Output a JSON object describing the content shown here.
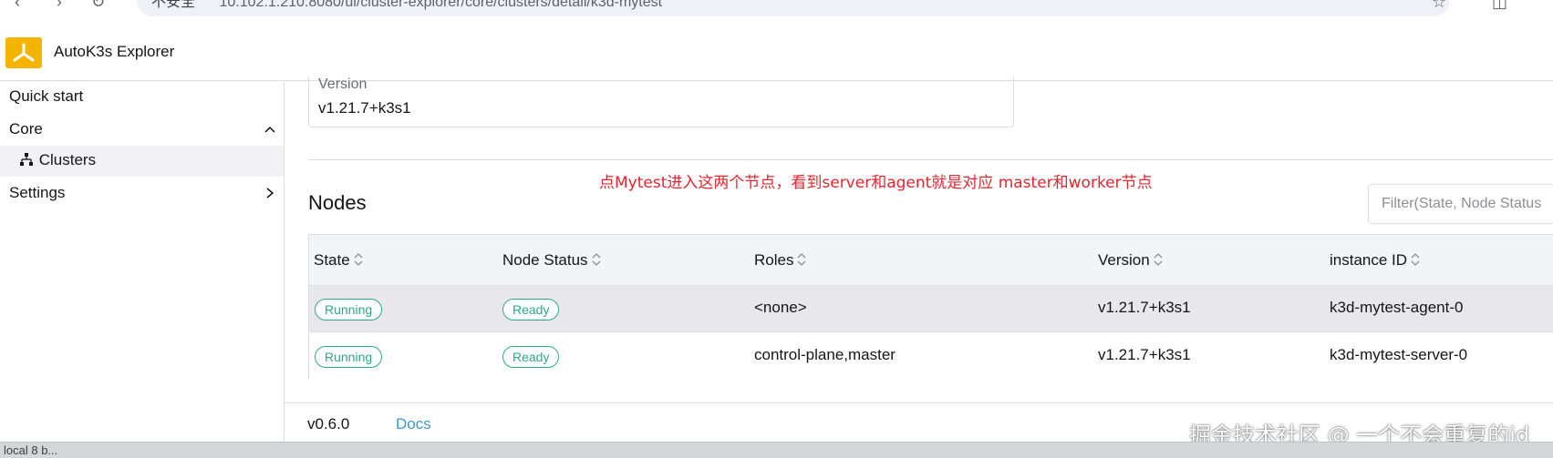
{
  "browser": {
    "insecure_label": "不安全",
    "url": "10.102.1.210:8080/ui/cluster-explorer/core/clusters/detail/k3d-mytest"
  },
  "header": {
    "title": "AutoK3s Explorer",
    "brand_color": "#f5b400"
  },
  "sidebar": {
    "items": [
      {
        "label": "Quick start"
      },
      {
        "label": "Core",
        "expanded": true
      },
      {
        "label": "Clusters",
        "selected": true,
        "icon": "cluster-tree-icon"
      },
      {
        "label": "Settings",
        "expanded": false
      }
    ]
  },
  "cluster": {
    "version_label": "Version",
    "version_value": "v1.21.7+k3s1"
  },
  "annotation": "点Mytest进入这两个节点，看到server和agent就是对应 master和worker节点",
  "nodes": {
    "title": "Nodes",
    "filter_placeholder": "Filter(State, Node Status",
    "columns": [
      "State",
      "Node Status",
      "Roles",
      "Version",
      "instance ID"
    ],
    "rows": [
      {
        "state": "Running",
        "node_status": "Ready",
        "roles": "<none>",
        "version": "v1.21.7+k3s1",
        "instance_id": "k3d-mytest-agent-0"
      },
      {
        "state": "Running",
        "node_status": "Ready",
        "roles": "control-plane,master",
        "version": "v1.21.7+k3s1",
        "instance_id": "k3d-mytest-server-0"
      }
    ]
  },
  "footer": {
    "version": "v0.6.0",
    "docs_label": "Docs"
  },
  "watermark": "掘金技术社区 @ 一个不会重复的id",
  "status_bar": {
    "text": "local 8 b..."
  },
  "colors": {
    "badge": "#2ea88a",
    "annotation": "#e0262f",
    "link": "#3d98d3"
  }
}
